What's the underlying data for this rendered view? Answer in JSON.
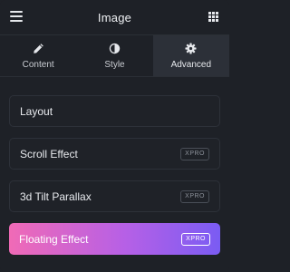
{
  "header": {
    "title": "Image"
  },
  "tabs": [
    {
      "label": "Content",
      "icon": "pencil-icon",
      "active": false
    },
    {
      "label": "Style",
      "icon": "contrast-icon",
      "active": false
    },
    {
      "label": "Advanced",
      "icon": "gear-icon",
      "active": true
    }
  ],
  "sections": [
    {
      "label": "Layout",
      "badge": null
    },
    {
      "label": "Scroll Effect",
      "badge": "XPRO"
    },
    {
      "label": "3d Tilt Parallax",
      "badge": "XPRO"
    },
    {
      "label": "Floating Effect",
      "badge": "XPRO",
      "highlighted": true
    }
  ],
  "colors": {
    "background": "#1e2127",
    "active_tab": "#2c3038",
    "gradient_start": "#f06ab6",
    "gradient_end": "#7a5cf3"
  }
}
